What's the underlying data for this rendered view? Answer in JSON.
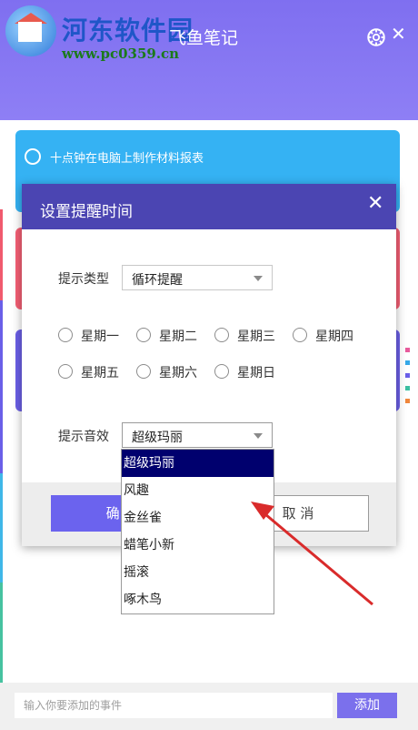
{
  "watermark": {
    "title": "河东软件园",
    "url": "www.pc0359.cn"
  },
  "app": {
    "title": "飞鱼笔记"
  },
  "header": {
    "settings_icon": "gear-icon",
    "close_icon": "close-icon",
    "close_glyph": "✕"
  },
  "task": {
    "text": "十点钟在电脑上制作材料报表"
  },
  "dialog": {
    "title": "设置提醒时间",
    "close_glyph": "✕",
    "type_label": "提示类型",
    "type_value": "循环提醒",
    "weekdays": [
      "星期一",
      "星期二",
      "星期三",
      "星期四",
      "星期五",
      "星期六",
      "星期日"
    ],
    "sound_label": "提示音效",
    "sound_value": "超级玛丽",
    "sound_options": [
      "超级玛丽",
      "风趣",
      "金丝雀",
      "蜡笔小新",
      "摇滚",
      "啄木鸟"
    ],
    "ok_label": "确 定",
    "cancel_label": "取 消"
  },
  "footer": {
    "input_placeholder": "输入你要添加的事件",
    "add_label": "添加"
  },
  "colors": {
    "header": "#7f6ff0",
    "dialog_header": "#4b45b2",
    "task_card": "#35b2f3",
    "selection": "#00006e",
    "annotation_arrow": "#d92b2b"
  }
}
